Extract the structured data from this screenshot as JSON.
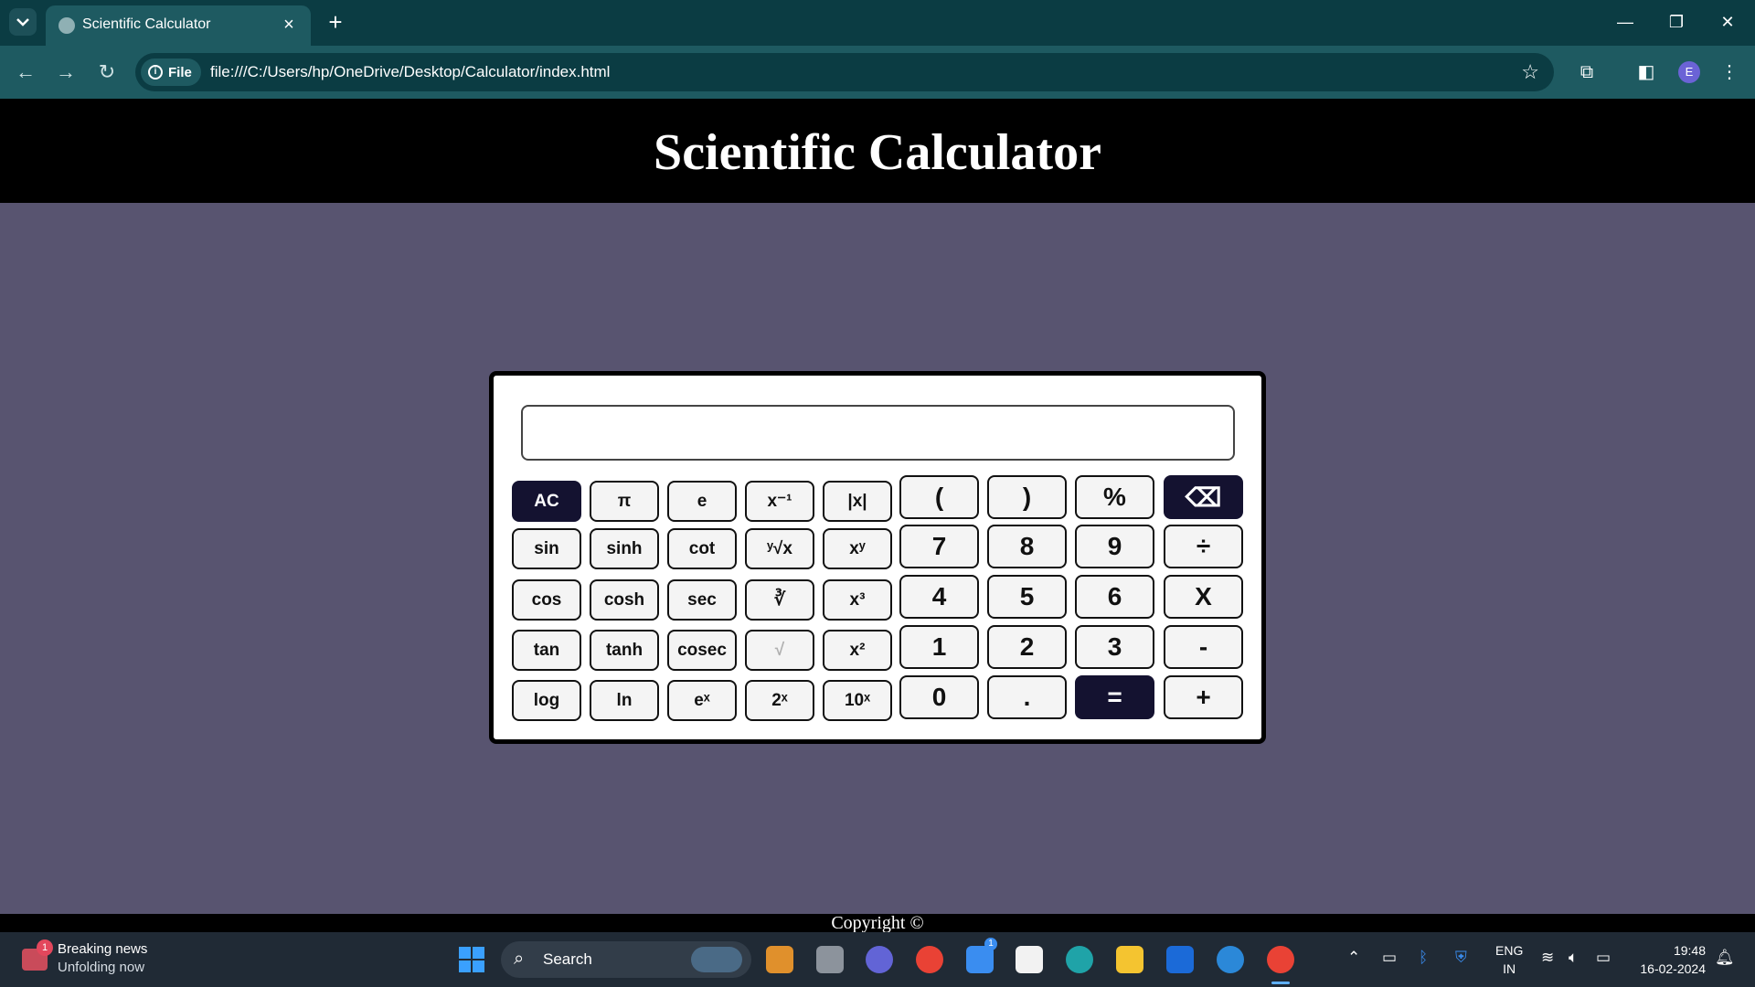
{
  "browser": {
    "tab_title": "Scientific Calculator",
    "tab_close": "×",
    "new_tab": "+",
    "site_chip": "File",
    "url": "file:///C:/Users/hp/OneDrive/Desktop/Calculator/index.html",
    "profile_initial": "E",
    "window_controls": {
      "minimize": "—",
      "restore": "❐",
      "close": "✕"
    },
    "nav": {
      "back": "←",
      "forward": "→",
      "reload": "↻"
    }
  },
  "page": {
    "title": "Scientific Calculator",
    "display_value": "",
    "footer": "Copyright ©"
  },
  "calculator": {
    "sci_rows": [
      [
        "AC",
        "π",
        "e",
        "x⁻¹",
        "|x|"
      ],
      [
        "sin",
        "sinh",
        "cot",
        "ʸ√x",
        "xʸ"
      ],
      [
        "cos",
        "cosh",
        "sec",
        "∛",
        "x³"
      ],
      [
        "tan",
        "tanh",
        "cosec",
        "√",
        "x²"
      ],
      [
        "log",
        "ln",
        "eˣ",
        "2ˣ",
        "10ˣ"
      ]
    ],
    "num_rows": [
      [
        "(",
        ")",
        "%",
        "⌫"
      ],
      [
        "7",
        "8",
        "9",
        "÷"
      ],
      [
        "4",
        "5",
        "6",
        "X"
      ],
      [
        "1",
        "2",
        "3",
        "-"
      ],
      [
        "0",
        ".",
        "=",
        "+"
      ]
    ],
    "colors": {
      "dark_key": "#141230",
      "panel": "#ffffff",
      "page_bg": "#585470"
    }
  },
  "taskbar": {
    "news_title": "Breaking news",
    "news_subtitle": "Unfolding now",
    "news_badge": "1",
    "search_label": "Search",
    "mail_badge": "1",
    "lang_line1": "ENG",
    "lang_line2": "IN",
    "time": "19:48",
    "date": "16-02-2024"
  }
}
